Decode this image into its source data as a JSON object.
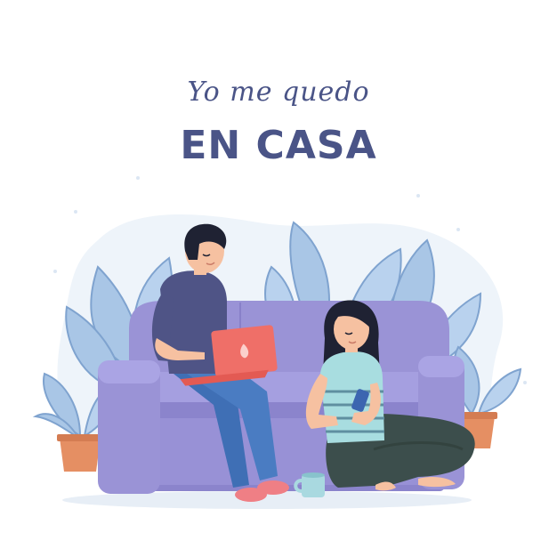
{
  "heading": {
    "script_line": "Yo me quedo",
    "main_line": "EN CASA"
  },
  "colors": {
    "title": "#4a5487",
    "backdrop": "#eef4fa",
    "sofa": "#9a93d6",
    "sofa_dark": "#7e77c0",
    "leaf": "#a9c6e6",
    "leaf_vein": "#7fa3cf",
    "pot": "#e58f63",
    "laptop": "#ef6f68",
    "man_shirt": "#4f5486",
    "jeans": "#3f6fb5",
    "woman_pants": "#3c4e4c",
    "woman_top": "#a8dde0",
    "skin": "#f6c1a1",
    "hair": "#1f2233",
    "mug": "#a9d9e0"
  },
  "icons": [
    "laptop-logo-icon",
    "smartphone-icon",
    "mug-icon",
    "plant-icon",
    "sofa-icon"
  ]
}
